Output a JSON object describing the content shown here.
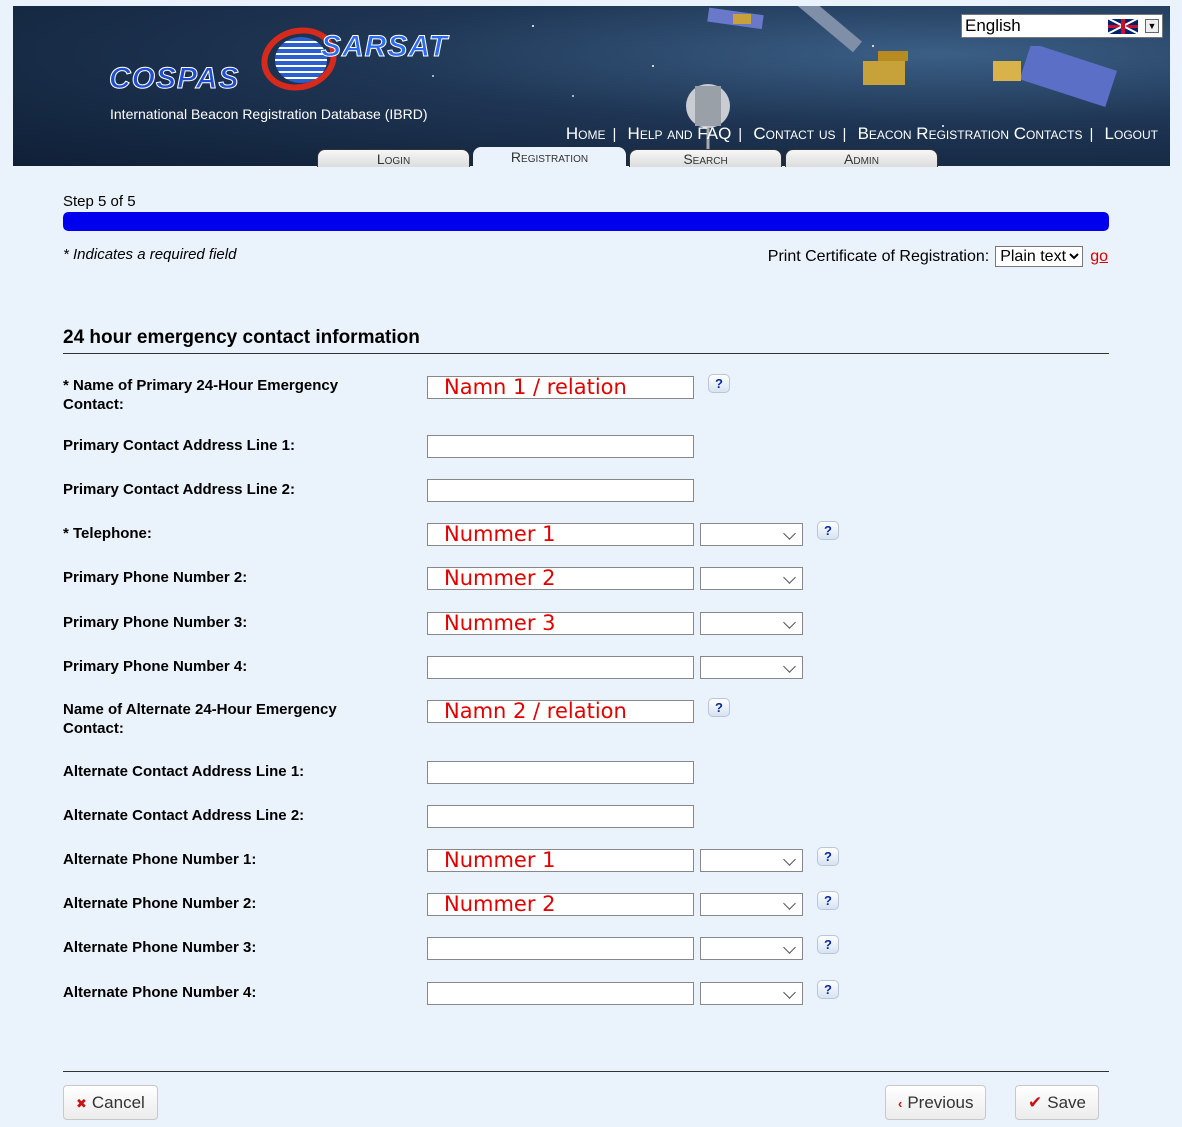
{
  "header": {
    "logo_top": "SARSAT",
    "logo_bottom": "COSPAS",
    "subtitle": "International Beacon Registration Database (IBRD)",
    "language": "English",
    "nav": [
      "Home",
      "Help and FAQ",
      "Contact us",
      "Beacon Registration Contacts",
      "Logout"
    ],
    "tabs": [
      "Login",
      "Registration",
      "Search",
      "Admin"
    ],
    "active_tab": "Registration"
  },
  "progress": {
    "label": "Step 5 of 5",
    "value": 1.0,
    "color": "#0000ee"
  },
  "required_note": "* Indicates a required field",
  "print": {
    "label": "Print Certificate of Registration:",
    "format": "Plain text",
    "go_label": "go"
  },
  "section_title": "24 hour emergency contact information",
  "fields": [
    {
      "label_line1": "* Name of Primary 24-Hour Emergency",
      "label_line2": "Contact:",
      "value": "Namn 1 / relation",
      "has_select": false,
      "has_help": true
    },
    {
      "label_line1": "Primary Contact Address Line 1:",
      "value": "",
      "has_select": false,
      "has_help": false
    },
    {
      "label_line1": "Primary Contact Address Line 2:",
      "value": "",
      "has_select": false,
      "has_help": false
    },
    {
      "label_line1": "* Telephone:",
      "value": "Nummer 1",
      "has_select": true,
      "has_help": true
    },
    {
      "label_line1": "Primary Phone Number 2:",
      "value": "Nummer 2",
      "has_select": true,
      "has_help": false
    },
    {
      "label_line1": "Primary Phone Number 3:",
      "value": "Nummer 3",
      "has_select": true,
      "has_help": false
    },
    {
      "label_line1": "Primary Phone Number 4:",
      "value": "",
      "has_select": true,
      "has_help": false
    },
    {
      "label_line1": "Name of Alternate 24-Hour Emergency",
      "label_line2": "Contact:",
      "value": "Namn 2 / relation",
      "has_select": false,
      "has_help": true
    },
    {
      "label_line1": "Alternate Contact Address Line 1:",
      "value": "",
      "has_select": false,
      "has_help": false
    },
    {
      "label_line1": "Alternate Contact Address Line 2:",
      "value": "",
      "has_select": false,
      "has_help": false
    },
    {
      "label_line1": "Alternate Phone Number 1:",
      "value": "Nummer 1",
      "has_select": true,
      "has_help": true
    },
    {
      "label_line1": "Alternate Phone Number 2:",
      "value": "Nummer 2",
      "has_select": true,
      "has_help": true
    },
    {
      "label_line1": "Alternate Phone Number 3:",
      "value": "",
      "has_select": true,
      "has_help": true
    },
    {
      "label_line1": "Alternate Phone Number 4:",
      "value": "",
      "has_select": true,
      "has_help": true
    }
  ],
  "help_glyph": "?",
  "buttons": {
    "cancel": "Cancel",
    "previous": "Previous",
    "save": "Save"
  },
  "icons": {
    "cancel": "x-icon",
    "previous": "chevron-left-icon",
    "save": "checkmark-icon",
    "help": "question-icon",
    "flag": "uk-flag-icon"
  }
}
